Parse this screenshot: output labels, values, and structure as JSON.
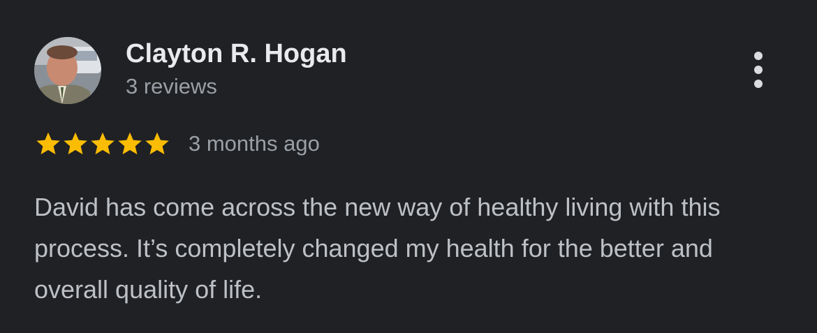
{
  "review": {
    "reviewer_name": "Clayton R. Hogan",
    "reviewer_meta": "3 reviews",
    "rating": 5,
    "rating_max": 5,
    "date": "3 months ago",
    "text": "David has come across the new way of healthy living with this process. It’s completely changed my health for the better and overall quality of life."
  },
  "icons": {
    "avatar": "avatar-photo",
    "menu": "more-vertical-icon",
    "star": "star-icon"
  },
  "colors": {
    "background": "#202124",
    "star": "#fbbc04",
    "name": "#e8eaed",
    "meta": "#9aa0a6",
    "body_text": "#bdc1c6"
  }
}
